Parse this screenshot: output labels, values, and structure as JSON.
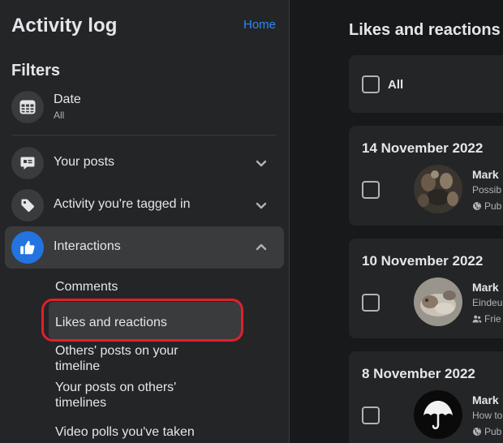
{
  "sidebar": {
    "title": "Activity log",
    "home_link": "Home",
    "filters_heading": "Filters",
    "date_filter": {
      "label": "Date",
      "value": "All",
      "icon": "calendar-icon"
    },
    "categories": [
      {
        "label": "Your posts",
        "icon": "comment-bubble-icon",
        "expanded": false
      },
      {
        "label": "Activity you're tagged in",
        "icon": "tag-icon",
        "expanded": false
      },
      {
        "label": "Interactions",
        "icon": "thumbs-up-icon",
        "expanded": true
      }
    ],
    "interaction_subitems": [
      "Comments",
      "Likes and reactions",
      "Others' posts on your timeline",
      "Your posts on others' timelines",
      "Video polls you've taken"
    ],
    "selected_subitem": "Likes and reactions"
  },
  "main": {
    "title": "Likes and reactions",
    "select_all_label": "All",
    "groups": [
      {
        "date": "14 November 2022",
        "entry": {
          "name": "Mark",
          "description": "Possib",
          "audience": "Pub",
          "audience_icon": "globe-icon"
        }
      },
      {
        "date": "10 November 2022",
        "entry": {
          "name": "Mark",
          "description": "Eindeu",
          "audience": "Frie",
          "audience_icon": "friends-icon"
        }
      },
      {
        "date": "8 November 2022",
        "entry": {
          "name": "Mark",
          "description": "How to",
          "audience": "Pub",
          "audience_icon": "globe-icon"
        }
      }
    ]
  },
  "colors": {
    "accent": "#2374e1",
    "link": "#2d88ff",
    "highlight_ring": "#e0202c",
    "sidebar_bg": "#242526",
    "page_bg": "#18191a"
  }
}
